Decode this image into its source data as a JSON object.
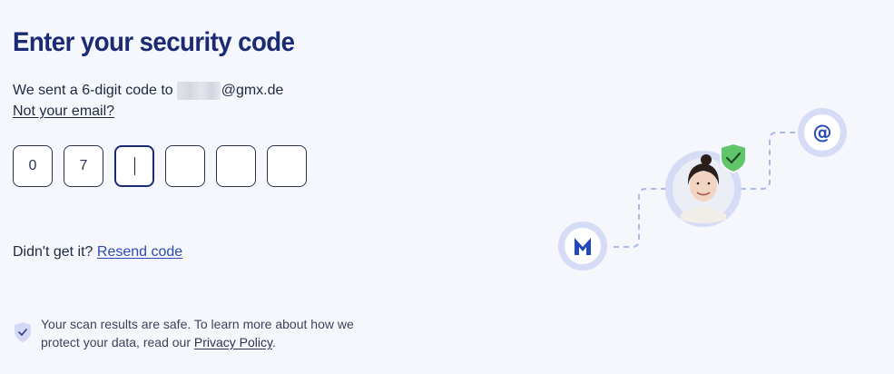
{
  "heading": "Enter your security code",
  "sent": {
    "prefix": "We sent a 6-digit code to",
    "email_suffix": "@gmx.de"
  },
  "not_your_email": "Not your email?",
  "code": {
    "digits": [
      "0",
      "7",
      "",
      "",
      "",
      ""
    ],
    "active_index": 2
  },
  "resend": {
    "prompt": "Didn't get it?",
    "link": "Resend code"
  },
  "privacy": {
    "text": "Your scan results are safe. To learn more about how we protect your data, read our",
    "link": "Privacy Policy",
    "period": "."
  },
  "illustration": {
    "icons": [
      "malwarebytes-logo-icon",
      "user-avatar",
      "verified-shield-icon",
      "at-sign-icon"
    ],
    "at_symbol": "@",
    "colors": {
      "accent": "#1a2a73",
      "ring": "#d6dcf5",
      "link_blue": "#2a4bb5",
      "shield_green": "#5fc46a",
      "dashed_line": "#aab8ea"
    }
  }
}
